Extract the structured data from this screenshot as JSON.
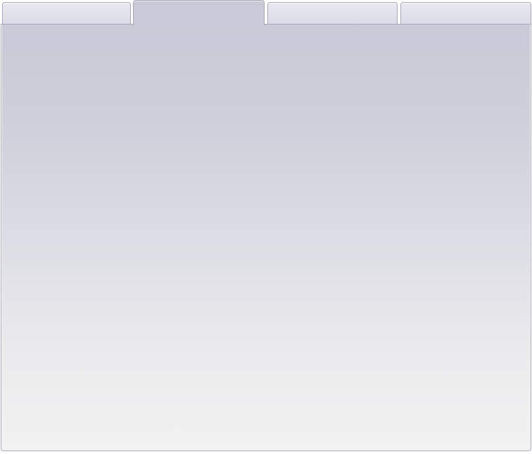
{
  "tabs": [
    {
      "label": "",
      "active": false
    },
    {
      "label": "",
      "active": true
    },
    {
      "label": "",
      "active": false
    },
    {
      "label": "",
      "active": false
    }
  ],
  "panel": {
    "content": ""
  },
  "colors": {
    "tab_border": "#a7a7b7",
    "active_tab": "#c9c9d7",
    "panel_bottom": "#f2f2f2"
  }
}
